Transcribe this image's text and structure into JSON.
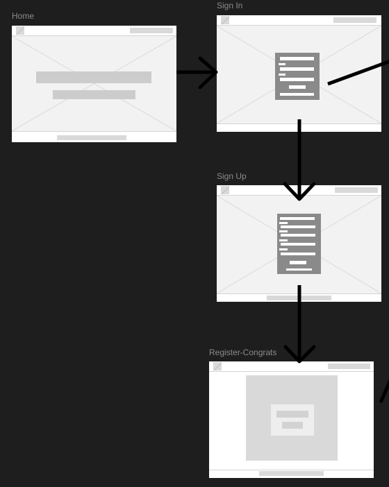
{
  "frames": {
    "home": {
      "label": "Home"
    },
    "sign_in": {
      "label": "Sign In"
    },
    "sign_up": {
      "label": "Sign Up"
    },
    "register_congrats": {
      "label": "Register-Congrats"
    }
  },
  "colors": {
    "canvas": "#1e1e1e",
    "frame": "#ffffff",
    "placeholder": "#f2f2f2",
    "bar": "#cccccc",
    "form": "#8a8a8a",
    "arrow": "#000000"
  }
}
